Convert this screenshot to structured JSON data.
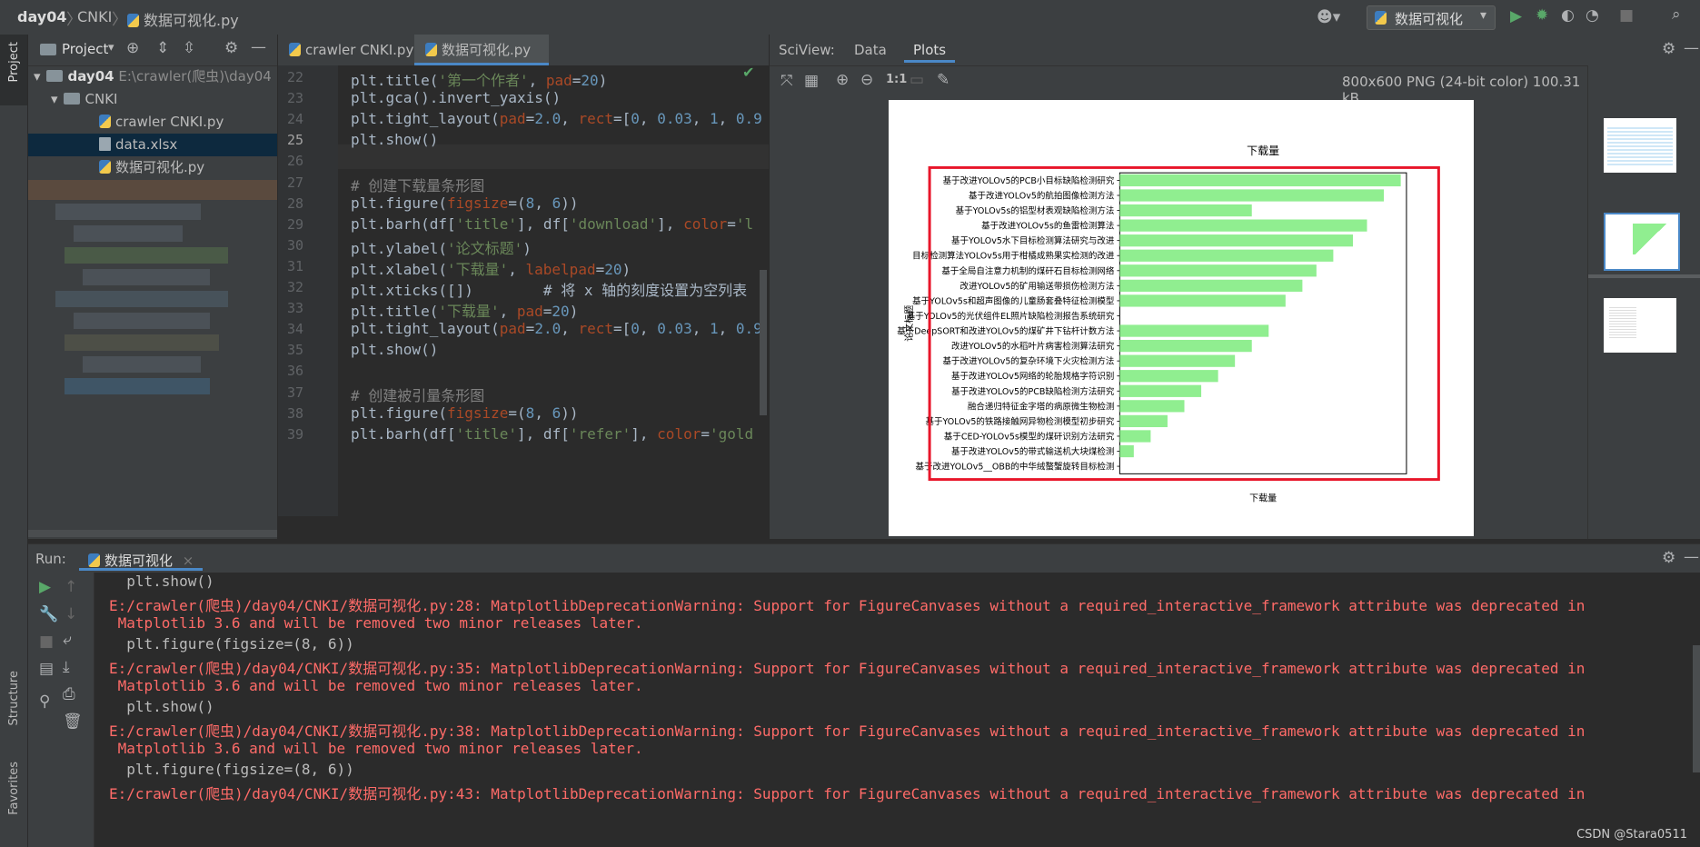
{
  "breadcrumb": [
    "day04",
    "CNKI",
    "数据可视化.py"
  ],
  "run_config": "数据可视化",
  "project": {
    "header": "Project",
    "root": "day04",
    "root_path": "E:\\crawler(爬虫)\\day04",
    "folder": "CNKI",
    "files": [
      "crawler CNKI.py",
      "data.xlsx",
      "数据可视化.py"
    ]
  },
  "editor": {
    "tabs": [
      "crawler CNKI.py",
      "数据可视化.py"
    ],
    "lines": [
      {
        "n": "22",
        "t": "plt.title('第一个作者', pad=20)"
      },
      {
        "n": "23",
        "t": "plt.gca().invert_yaxis()"
      },
      {
        "n": "24",
        "t": "plt.tight_layout(pad=2.0, rect=[0, 0.03, 1, 0.9"
      },
      {
        "n": "25",
        "t": "plt.show()"
      },
      {
        "n": "26",
        "t": ""
      },
      {
        "n": "27",
        "t": "# 创建下载量条形图"
      },
      {
        "n": "28",
        "t": "plt.figure(figsize=(8, 6))"
      },
      {
        "n": "29",
        "t": "plt.barh(df['title'], df['download'], color='l"
      },
      {
        "n": "30",
        "t": "plt.ylabel('论文标题')"
      },
      {
        "n": "31",
        "t": "plt.xlabel('下载量', labelpad=20)"
      },
      {
        "n": "32",
        "t": "plt.xticks([])        # 将 x 轴的刻度设置为空列表"
      },
      {
        "n": "33",
        "t": "plt.title('下载量', pad=20)"
      },
      {
        "n": "34",
        "t": "plt.tight_layout(pad=2.0, rect=[0, 0.03, 1, 0.9"
      },
      {
        "n": "35",
        "t": "plt.show()"
      },
      {
        "n": "36",
        "t": ""
      },
      {
        "n": "37",
        "t": "# 创建被引量条形图"
      },
      {
        "n": "38",
        "t": "plt.figure(figsize=(8, 6))"
      },
      {
        "n": "39",
        "t": "plt.barh(df['title'], df['refer'], color='gold"
      }
    ]
  },
  "sciview": {
    "label": "SciView:",
    "tabs": [
      "Data",
      "Plots"
    ],
    "image_info": "800x600 PNG (24-bit color) 100.31 kB",
    "zoom_actual": "1:1"
  },
  "chart_data": {
    "type": "bar",
    "orientation": "horizontal",
    "title": "下载量",
    "xlabel": "下载量",
    "ylabel": "论文标题",
    "xticks": [],
    "color": "#90ee90",
    "categories": [
      "基于改进YOLOv5的PCB小目标缺陷检测研究",
      "基于改进YOLOv5的航拍图像检测方法",
      "基于YOLOv5s的铝型材表观缺陷检测方法",
      "基于改进YOLOv5s的鱼雷检测算法",
      "基于YOLOv5水下目标检测算法研究与改进",
      "目标检测算法YOLOv5s用于柑橘成熟果实检测的改进",
      "基于全局自注意力机制的煤矸石目标检测网络",
      "改进YOLOv5的矿用输送带损伤检测方法",
      "基于YOLOv5s和超声图像的儿童肠套叠特征检测模型",
      "基于YOLOv5的光伏组件EL照片缺陷检测报告系统研究",
      "基于DeepSORT和改进YOLOv5的煤矿井下钻杆计数方法",
      "改进YOLOv5的水稻叶片病害检测算法研究",
      "基于改进YOLOv5的复杂环境下火灾检测方法",
      "基于改进YOLOv5网络的轮胎规格字符识别",
      "基于改进YOLOv5的PCB缺陷检测方法研究",
      "融合递归特征金字塔的病原微生物检测",
      "基于YOLOv5的铁路接触网异物检测模型初步研究",
      "基于CED-YOLOv5s模型的煤矸识别方法研究",
      "基于改进YOLOv5的带式输送机大块煤检测",
      "基于改进YOLOv5__OBB的中华绒螯蟹旋转目标检测"
    ],
    "values": [
      100,
      94,
      47,
      88,
      83,
      76,
      70,
      65,
      59,
      0,
      53,
      47,
      41,
      35,
      29,
      23,
      17,
      11,
      5,
      0
    ]
  },
  "run": {
    "label": "Run:",
    "tab": "数据可视化",
    "console": [
      {
        "cls": "norm",
        "t": "  plt.show()"
      },
      {
        "cls": "red",
        "t": "E:/crawler(爬虫)/day04/CNKI/数据可视化.py:28: MatplotlibDeprecationWarning: Support for FigureCanvases without a required_interactive_framework attribute was deprecated in"
      },
      {
        "cls": "red",
        "t": " Matplotlib 3.6 and will be removed two minor releases later."
      },
      {
        "cls": "norm",
        "t": "  plt.figure(figsize=(8, 6))"
      },
      {
        "cls": "red",
        "t": "E:/crawler(爬虫)/day04/CNKI/数据可视化.py:35: MatplotlibDeprecationWarning: Support for FigureCanvases without a required_interactive_framework attribute was deprecated in"
      },
      {
        "cls": "red",
        "t": " Matplotlib 3.6 and will be removed two minor releases later."
      },
      {
        "cls": "norm",
        "t": "  plt.show()"
      },
      {
        "cls": "red",
        "t": "E:/crawler(爬虫)/day04/CNKI/数据可视化.py:38: MatplotlibDeprecationWarning: Support for FigureCanvases without a required_interactive_framework attribute was deprecated in"
      },
      {
        "cls": "red",
        "t": " Matplotlib 3.6 and will be removed two minor releases later."
      },
      {
        "cls": "norm",
        "t": "  plt.figure(figsize=(8, 6))"
      },
      {
        "cls": "red",
        "t": "E:/crawler(爬虫)/day04/CNKI/数据可视化.py:43: MatplotlibDeprecationWarning: Support for FigureCanvases without a required_interactive_framework attribute was deprecated in"
      }
    ]
  },
  "side_tabs": [
    "Project",
    "Structure",
    "Favorites"
  ],
  "watermark": "CSDN @Stara0511"
}
